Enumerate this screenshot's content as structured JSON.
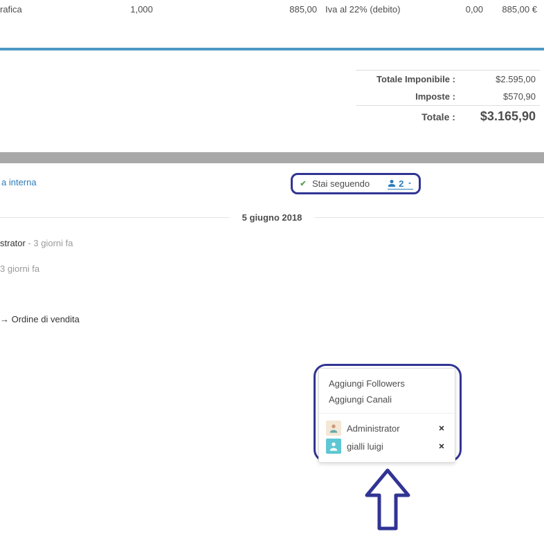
{
  "line": {
    "description": "rafica",
    "qty": "1,000",
    "price": "885,00",
    "tax": "Iva al 22% (debito)",
    "discount": "0,00",
    "total": "885,00 €"
  },
  "totals": {
    "subtotal_label": "Totale Imponibile :",
    "subtotal_value": "$2.595,00",
    "taxes_label": "Imposte :",
    "taxes_value": "$570,90",
    "grand_label": "Totale :",
    "grand_value": "$3.165,90"
  },
  "chatter": {
    "note_link": "a interna",
    "follow_label": "Stai seguendo",
    "followers_count": "2",
    "date_label": "5 giugno 2018"
  },
  "popup": {
    "add_followers": "Aggiungi Followers",
    "add_channels": "Aggiungi Canali",
    "f1_name": "Administrator",
    "f2_name": "gialli luigi"
  },
  "logs": {
    "e1_actor": "strator",
    "e1_when": " - 3 giorni fa",
    "e2_when": "3 giorni fa"
  },
  "breadcrumb": {
    "text": " → Ordine di vendita"
  }
}
